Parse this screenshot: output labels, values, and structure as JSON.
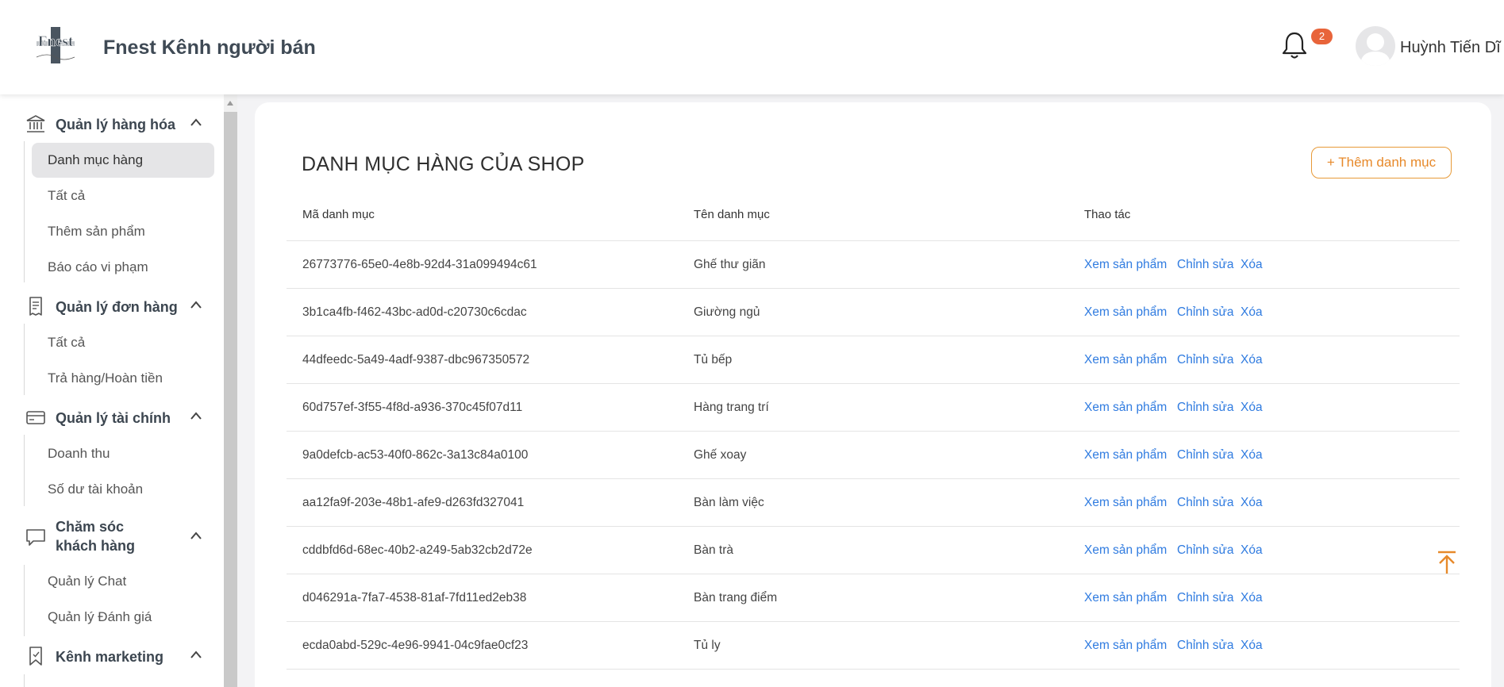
{
  "header": {
    "logo_text": "Fnest",
    "brand": "Fnest Kênh người bán",
    "notification_count": "2",
    "username": "Huỳnh Tiến Dĩ"
  },
  "sidebar": {
    "sections": [
      {
        "title": "Quản lý hàng hóa",
        "icon": "bank-icon",
        "items": [
          "Danh mục hàng",
          "Tất cả",
          "Thêm sản phẩm",
          "Báo cáo vi phạm"
        ]
      },
      {
        "title": "Quản lý đơn hàng",
        "icon": "receipt-icon",
        "items": [
          "Tất cả",
          "Trả hàng/Hoàn tiền"
        ]
      },
      {
        "title": "Quản lý tài chính",
        "icon": "credit-card-icon",
        "items": [
          "Doanh thu",
          "Số dư tài khoản"
        ]
      },
      {
        "title_line1": "Chăm sóc",
        "title_line2": "khách hàng",
        "icon": "chat-icon",
        "items": [
          "Quản lý Chat",
          "Quản lý Đánh giá"
        ]
      },
      {
        "title": "Kênh marketing",
        "icon": "bookmark-icon",
        "items": []
      }
    ],
    "active_item": "Danh mục hàng"
  },
  "main": {
    "title": "DANH MỤC HÀNG CỦA SHOP",
    "add_button": "+ Thêm danh mục",
    "columns": [
      "Mã danh mục",
      "Tên danh mục",
      "Thao tác"
    ],
    "actions": [
      "Xem sản phẩm",
      "Chỉnh sửa",
      "Xóa"
    ],
    "rows": [
      {
        "id": "26773776-65e0-4e8b-92d4-31a099494c61",
        "name": "Ghế thư giãn"
      },
      {
        "id": "3b1ca4fb-f462-43bc-ad0d-c20730c6cdac",
        "name": "Giường ngủ"
      },
      {
        "id": "44dfeedc-5a49-4adf-9387-dbc967350572",
        "name": "Tủ bếp"
      },
      {
        "id": "60d757ef-3f55-4f8d-a936-370c45f07d11",
        "name": "Hàng trang trí"
      },
      {
        "id": "9a0defcb-ac53-40f0-862c-3a13c84a0100",
        "name": "Ghế xoay"
      },
      {
        "id": "aa12fa9f-203e-48b1-afe9-d263fd327041",
        "name": "Bàn làm việc"
      },
      {
        "id": "cddbfd6d-68ec-40b2-a249-5ab32cb2d72e",
        "name": "Bàn trà"
      },
      {
        "id": "d046291a-7fa7-4538-81af-7fd11ed2eb38",
        "name": "Bàn trang điểm"
      },
      {
        "id": "ecda0abd-529c-4e96-9941-04c9fae0cf23",
        "name": "Tủ ly"
      }
    ]
  },
  "colors": {
    "accent": "#e7892a",
    "link": "#2f7be0",
    "badge": "#e8643a"
  }
}
